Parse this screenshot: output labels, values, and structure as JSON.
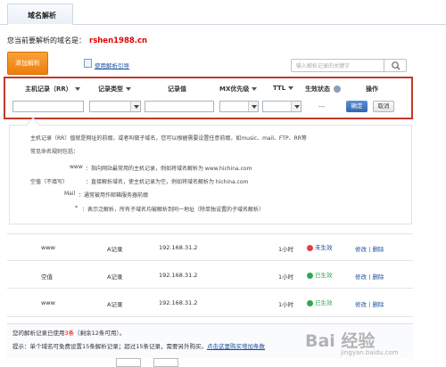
{
  "tab": {
    "label": "域名解析"
  },
  "domain": {
    "prefix": "您当前要解析的域名是：",
    "name": "rshen1988.cn"
  },
  "toolbar": {
    "add_label": "添加解析",
    "help_label": "使用解析引导",
    "search_placeholder": "输入解析记录的关键字"
  },
  "columns": [
    "主机记录（RR）",
    "记录类型",
    "记录值",
    "MX优先级",
    "TTL",
    "生效状态",
    "操作"
  ],
  "edit_row": {
    "dash": "---",
    "ok_label": "确定",
    "cancel_label": "取消"
  },
  "info": {
    "intro1": "主机记录（RR）值就是网址的前缀，或者叫做子域名，您可以根据需要设置任意前缀，如music、mail、FTP、RR等",
    "intro2": "常见命名规则包括：",
    "items": [
      {
        "key": "www",
        "desc": "：指向网站最常用的主机记录，例如将域名解析为 www.hichina.com"
      },
      {
        "key": "空值（不填写）",
        "desc": "：直接解析域名，使主机记录为空，例如将域名解析为 hichina.com"
      },
      {
        "key": "Mail",
        "desc": "：通常被用作邮箱服务器前缀"
      },
      {
        "key": "*",
        "desc": "：表示泛解析，所有子域名均被解析到同一地址（除单独设置的子域名解析）"
      }
    ]
  },
  "records": [
    {
      "host": "www",
      "type": "A记录",
      "value": "192.168.31.2",
      "ttl": "1小时",
      "status": "未生效",
      "status_color": "#e04040",
      "ops": "修改 | 删除"
    },
    {
      "host": "空值",
      "type": "A记录",
      "value": "192.168.31.2",
      "ttl": "1小时",
      "status": "已生效",
      "status_color": "#2fa84f",
      "ops": "修改 | 删除"
    },
    {
      "host": "www",
      "type": "A记录",
      "value": "192.168.31.2",
      "ttl": "1小时",
      "status": "已生效",
      "status_color": "#2fa84f",
      "ops": "修改 | 删除"
    }
  ],
  "footer": {
    "usage_prefix": "您的解析记录已使用",
    "usage_count": "3条",
    "usage_suffix": "（剩余12条可用）。",
    "tip": "提示：单个域名可免费设置15条解析记录；超过15条记录，需要另外购买。",
    "tip_link": "点击这里购买增加条数"
  },
  "watermark": {
    "brand": "Bai 经验",
    "url": "jingyan.baidu.com"
  }
}
